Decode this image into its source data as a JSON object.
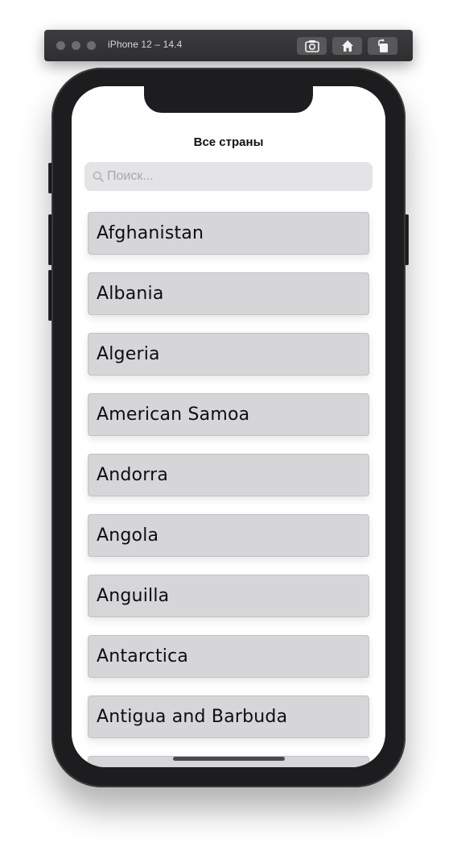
{
  "window": {
    "title": "iPhone 12 – 14.4"
  },
  "toolbar": {
    "icons": [
      "screenshot-icon",
      "home-icon",
      "rotate-icon"
    ]
  },
  "nav": {
    "title": "Все страны"
  },
  "search": {
    "placeholder": "Поиск...",
    "value": ""
  },
  "countries": [
    "Afghanistan",
    "Albania",
    "Algeria",
    "American Samoa",
    "Andorra",
    "Angola",
    "Anguilla",
    "Antarctica",
    "Antigua and Barbuda"
  ],
  "colors": {
    "row_background": "#d6d6d9",
    "search_background": "#e4e4e7",
    "phone_frame": "#1d1d1f"
  }
}
